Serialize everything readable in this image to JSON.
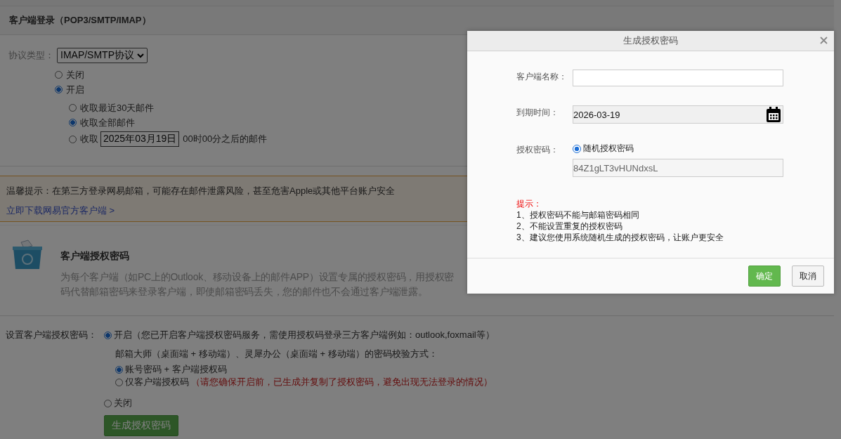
{
  "page": {
    "section_title": "客户端登录（POP3/SMTP/IMAP）",
    "protocol": {
      "label": "协议类型：",
      "value": "IMAP/SMTP协议"
    },
    "status_options": [
      {
        "label": "关闭",
        "selected": false
      },
      {
        "label": "开启",
        "selected": true
      }
    ],
    "fetch_options": [
      {
        "kind": "plain",
        "label": "收取最近30天邮件",
        "selected": false
      },
      {
        "kind": "plain",
        "label": "收取全部邮件",
        "selected": true
      },
      {
        "kind": "date",
        "label": "收取",
        "date": "2025年03月19日",
        "suffix": "00时00分之后的邮件",
        "selected": false
      }
    ],
    "notice": {
      "text": "温馨提示：在第三方登录网易邮箱，可能存在邮件泄露风险，甚至危害Apple或其他平台账户安全",
      "link": "立即下载网易官方客户端 >"
    },
    "auth_intro": {
      "title": "客户端授权密码",
      "description": "为每个客户端（如PC上的Outlook、移动设备上的邮件APP）设置专属的授权密码，用授权密码代替邮箱密码来登录客户端，即使邮箱密码丢失，您的邮件也不会通过客户端泄露。"
    },
    "auth_setting": {
      "label": "设置客户端授权密码：",
      "on_option": {
        "label": "开启",
        "note": "（您已开启客户端授权密码服务，需使用授权码登录三方客户端例如：outlook,foxmail等）",
        "selected": true
      },
      "verify_title": "邮箱大师（桌面端 + 移动端）、灵犀办公（桌面端 + 移动端）的密码校验方式：",
      "verify_options": [
        {
          "label": "账号密码 + 客户端授权码",
          "selected": true
        },
        {
          "label": "仅客户端授权码",
          "warning": "（请您确保开启前，已生成并复制了授权密码，避免出现无法登录的情况）",
          "selected": false
        }
      ],
      "off_option": {
        "label": "关闭",
        "selected": false
      },
      "generate_button": "生成授权密码"
    }
  },
  "dialog": {
    "title": "生成授权密码",
    "name_label": "客户端名称：",
    "expiry_label": "到期时间：",
    "expiry_value": "2026-03-19",
    "password_label": "授权密码：",
    "password_option": {
      "label": "随机授权密码",
      "selected": true
    },
    "password_value": "84Z1gLT3vHUNdxsL",
    "tips_title": "提示：",
    "tips": [
      "1、授权密码不能与邮箱密码相同",
      "2、不能设置重复的授权密码",
      "3、建议您使用系统随机生成的授权密码，让账户更安全"
    ],
    "buttons": [
      {
        "kind": "primary",
        "label": "确定"
      },
      {
        "kind": "secondary",
        "label": "取消"
      }
    ]
  }
}
